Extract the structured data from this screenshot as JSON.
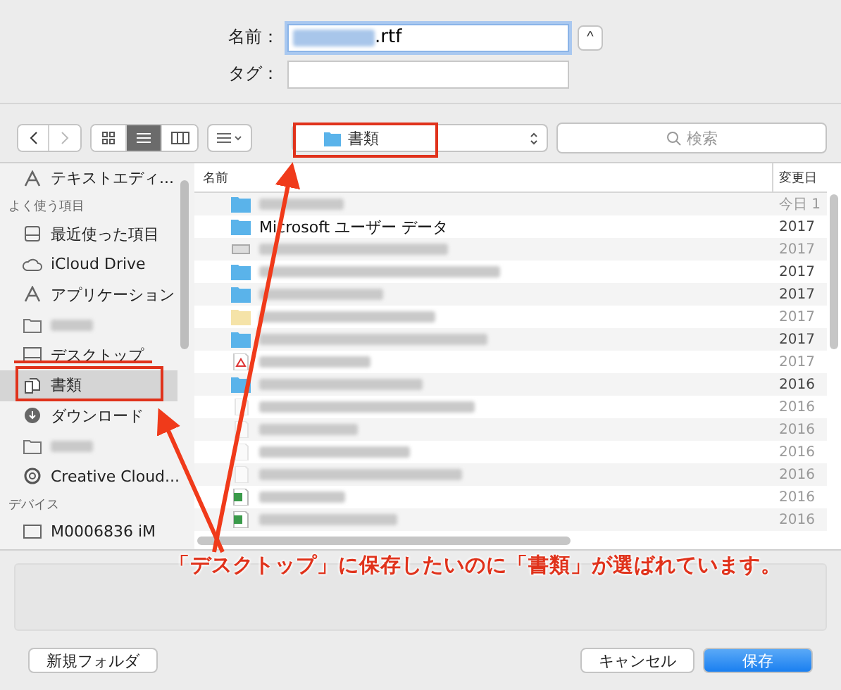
{
  "save_form": {
    "name_label": "名前：",
    "name_value": ".rtf",
    "tag_label": "タグ：",
    "expand_button": "^"
  },
  "toolbar": {
    "path": "書類",
    "search_placeholder": "検索",
    "view_modes": [
      {
        "kind": "icons",
        "selected": false
      },
      {
        "kind": "list",
        "selected": true
      },
      {
        "kind": "columns",
        "selected": false
      }
    ]
  },
  "sidebar": {
    "items": [
      {
        "kind": "app",
        "label": "テキストエディ...",
        "selected": false
      },
      {
        "kind": "heading",
        "label": "よく使う項目",
        "selected": false
      },
      {
        "kind": "recent",
        "label": "最近使った項目",
        "selected": false
      },
      {
        "kind": "cloud",
        "label": "iCloud Drive",
        "selected": false
      },
      {
        "kind": "app",
        "label": "アプリケーション",
        "selected": false
      },
      {
        "kind": "folder",
        "selected": false
      },
      {
        "kind": "desktop",
        "label": "デスクトップ",
        "selected": false
      },
      {
        "kind": "documents",
        "label": "書類",
        "selected": true
      },
      {
        "kind": "download",
        "label": "ダウンロード",
        "selected": false
      },
      {
        "kind": "folder",
        "selected": false
      },
      {
        "kind": "creative-cloud",
        "label": "Creative Cloud...",
        "selected": false
      },
      {
        "kind": "heading",
        "label": "デバイス",
        "selected": false
      },
      {
        "kind": "computer",
        "label": "M0006836 iM",
        "selected": false
      }
    ]
  },
  "file_list": {
    "columns": [
      "名前",
      "変更日"
    ],
    "rows": [
      {
        "kind": "folder",
        "date": "今日 1",
        "dimmed": true
      },
      {
        "kind": "folder",
        "name": "Microsoft ユーザー データ",
        "date": "2017",
        "dimmed": false
      },
      {
        "kind": "doc",
        "date": "2017",
        "dimmed": true
      },
      {
        "kind": "folder",
        "date": "2017",
        "dimmed": false
      },
      {
        "kind": "folder",
        "date": "2017",
        "dimmed": false
      },
      {
        "kind": "light-folder",
        "date": "2017",
        "dimmed": true
      },
      {
        "kind": "folder",
        "date": "2017",
        "dimmed": false
      },
      {
        "kind": "pdf",
        "date": "2017",
        "dimmed": true
      },
      {
        "kind": "folder",
        "date": "2016",
        "dimmed": false
      },
      {
        "kind": "blank",
        "date": "2016",
        "dimmed": true
      },
      {
        "kind": "blank",
        "date": "2016",
        "dimmed": true
      },
      {
        "kind": "blank",
        "date": "2016",
        "dimmed": true
      },
      {
        "kind": "blank",
        "date": "2016",
        "dimmed": true
      },
      {
        "kind": "excel",
        "date": "2016",
        "dimmed": true
      },
      {
        "kind": "excel",
        "date": "2016",
        "dimmed": true
      }
    ]
  },
  "buttons": {
    "new_folder": "新規フォルダ",
    "cancel": "キャンセル",
    "save": "保存"
  },
  "annotation": {
    "caption": "「デスクトップ」に保存したいのに「書類」が選ばれています。"
  }
}
